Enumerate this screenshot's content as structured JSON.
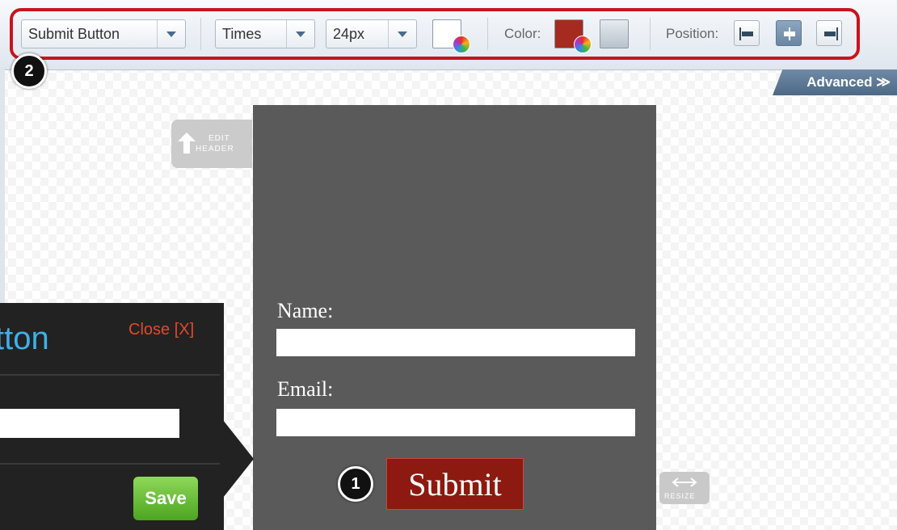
{
  "toolbar": {
    "element_select": "Submit Button",
    "font_select": "Times",
    "size_select": "24px",
    "color_label": "Color:",
    "position_label": "Position:",
    "colors": {
      "text_swatch": "#ffffff",
      "button_color": "#a52a1f",
      "border_swatch": "#cfd6dd"
    },
    "position_options": [
      "align-left-icon",
      "align-center-icon",
      "align-right-icon"
    ],
    "position_selected": "center"
  },
  "advanced": {
    "label": "Advanced ≫"
  },
  "callouts": {
    "first": "1",
    "second": "2"
  },
  "canvas": {
    "edit_header": {
      "line1": "EDIT",
      "line2": "HEADER"
    },
    "resize_label": "RESIZE"
  },
  "form": {
    "name_label": "Name:",
    "email_label": "Email:",
    "submit_label": "Submit",
    "panel_color": "#5a5a5a",
    "button_color": "#8c1a10"
  },
  "editor": {
    "title": "tton",
    "close_label": "Close [X]",
    "save_label": "Save"
  }
}
